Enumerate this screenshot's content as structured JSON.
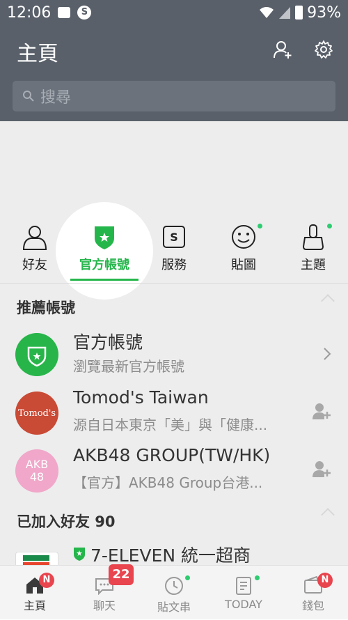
{
  "status_bar": {
    "time": "12:06",
    "s_icon": "S",
    "battery": "93%"
  },
  "header": {
    "title": "主頁",
    "search_placeholder": "搜尋"
  },
  "tabs": [
    {
      "label": "好友",
      "icon": "person-icon"
    },
    {
      "label": "官方帳號",
      "icon": "shield-star-icon",
      "active": true
    },
    {
      "label": "服務",
      "icon": "service-s-icon",
      "glyph": "S"
    },
    {
      "label": "貼圖",
      "icon": "smiley-icon",
      "dot": true
    },
    {
      "label": "主題",
      "icon": "brush-icon",
      "dot": true
    }
  ],
  "recommended": {
    "title": "推薦帳號",
    "items": [
      {
        "name": "官方帳號",
        "subtitle": "瀏覽最新官方帳號",
        "action": "chevron-right"
      },
      {
        "name": "Tomod's Taiwan",
        "subtitle": "源自日本東京「美」與「健康...",
        "avatar_text": "Tomod's",
        "action": "add-friend"
      },
      {
        "name": "AKB48 GROUP(TW/HK)",
        "subtitle": "【官方】AKB48 Group台港...",
        "avatar_text": "AKB 48",
        "action": "add-friend"
      }
    ]
  },
  "friends": {
    "title": "已加入好友 90",
    "items": [
      {
        "name": "7-ELEVEN 統一超商"
      }
    ]
  },
  "bottom_nav": [
    {
      "label": "主頁",
      "icon": "home-icon",
      "badge": "N",
      "active": true
    },
    {
      "label": "聊天",
      "icon": "chat-icon",
      "badge": "22"
    },
    {
      "label": "貼文串",
      "icon": "clock-icon",
      "dot": true
    },
    {
      "label": "TODAY",
      "icon": "news-icon",
      "dot": true
    },
    {
      "label": "錢包",
      "icon": "wallet-icon",
      "badge": "N"
    }
  ],
  "colors": {
    "header_bg": "#59606a",
    "accent_green": "#25b64b",
    "badge_red": "#e8454f"
  }
}
